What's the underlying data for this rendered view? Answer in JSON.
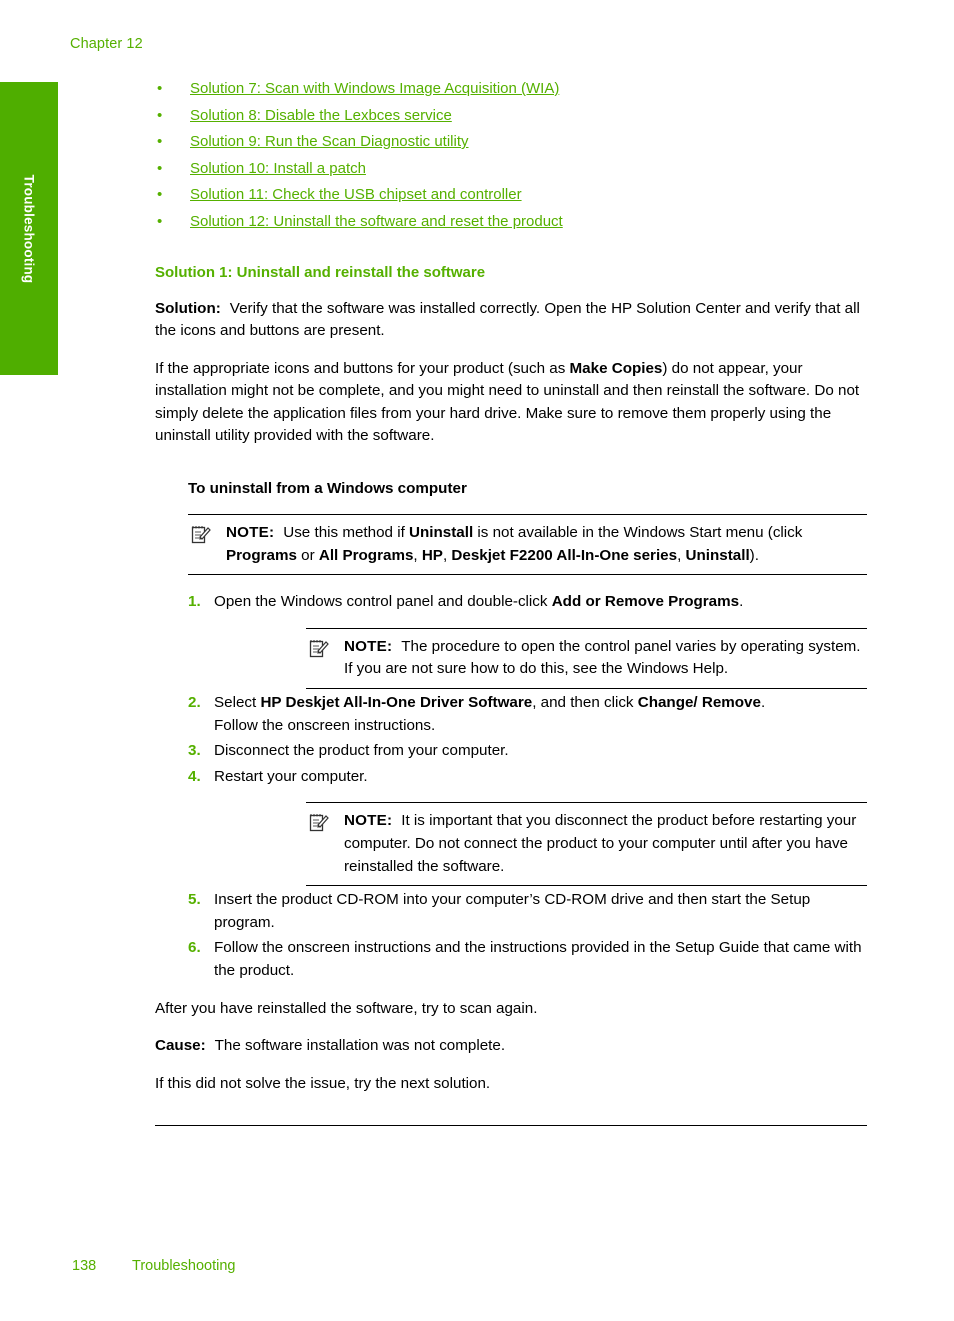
{
  "header": {
    "chapter": "Chapter 12"
  },
  "side_tab": {
    "label": "Troubleshooting"
  },
  "link_list": {
    "bullet": "•",
    "items": [
      "Solution 7: Scan with Windows Image Acquisition (WIA)",
      "Solution 8: Disable the Lexbces service",
      "Solution 9: Run the Scan Diagnostic utility",
      "Solution 10: Install a patch",
      "Solution 11: Check the USB chipset and controller",
      "Solution 12: Uninstall the software and reset the product"
    ]
  },
  "section": {
    "heading": "Solution 1: Uninstall and reinstall the software",
    "solution_label": "Solution:",
    "solution_text": "Verify that the software was installed correctly. Open the HP Solution Center and verify that all the icons and buttons are present.",
    "paragraph_2_a": "If the appropriate icons and buttons for your product (such as ",
    "paragraph_2_bold": "Make Copies",
    "paragraph_2_b": ") do not appear, your installation might not be complete, and you might need to uninstall and then reinstall the software. Do not simply delete the application files from your hard drive. Make sure to remove them properly using the uninstall utility provided with the software.",
    "subheading": "To uninstall from a Windows computer",
    "after_text": "After you have reinstalled the software, try to scan again.",
    "cause_label": "Cause:",
    "cause_text": "The software installation was not complete.",
    "next_solution_text": "If this did not solve the issue, try the next solution."
  },
  "notes": {
    "label": "NOTE:",
    "note_1": {
      "a": "Use this method if ",
      "b_uninstall": "Uninstall",
      "c": " is not available in the Windows Start menu (click ",
      "d_programs": "Programs",
      "e": " or ",
      "f_all_programs": "All Programs",
      "g": ", ",
      "h_hp": "HP",
      "i": ", ",
      "j_deskjet": "Deskjet F2200 All-In-One series",
      "k": ", ",
      "l_uninstall2": "Uninstall",
      "m": ")."
    },
    "note_2": {
      "text": "The procedure to open the control panel varies by operating system. If you are not sure how to do this, see the Windows Help."
    },
    "note_3": {
      "text": "It is important that you disconnect the product before restarting your computer. Do not connect the product to your computer until after you have reinstalled the software."
    }
  },
  "steps": {
    "step1": {
      "num": "1.",
      "a": "Open the Windows control panel and double-click ",
      "b_bold": "Add or Remove Programs",
      "c": "."
    },
    "step2": {
      "num": "2.",
      "a": "Select ",
      "b_bold": "HP Deskjet All-In-One Driver Software",
      "c": ", and then click ",
      "d_bold": "Change/ Remove",
      "e": ".",
      "sub": "Follow the onscreen instructions."
    },
    "step3": {
      "num": "3.",
      "text": "Disconnect the product from your computer."
    },
    "step4": {
      "num": "4.",
      "text": "Restart your computer."
    },
    "step5": {
      "num": "5.",
      "text": "Insert the product CD-ROM into your computer’s CD-ROM drive and then start the Setup program."
    },
    "step6": {
      "num": "6.",
      "text": "Follow the onscreen instructions and the instructions provided in the Setup Guide that came with the product."
    }
  },
  "footer": {
    "page_number": "138",
    "section_name": "Troubleshooting"
  },
  "colors": {
    "accent_green": "#55b000",
    "tab_green": "#4fae00",
    "text": "#000000"
  }
}
